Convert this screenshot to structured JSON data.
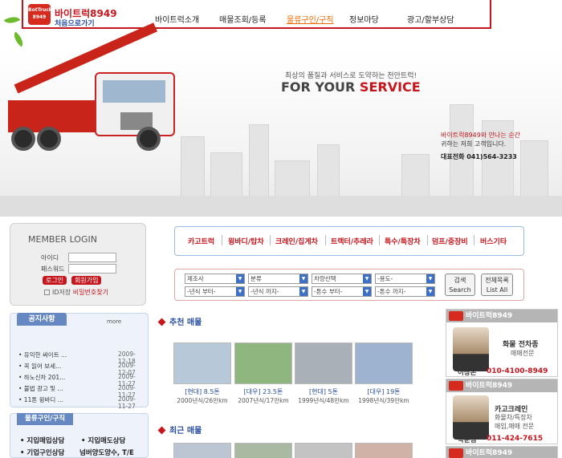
{
  "header": {
    "logo_text": "BotTruck 8949",
    "brand": "바이트럭8949",
    "brand_sub": "처음으로가기",
    "nav": [
      "바이트럭소개",
      "매물조회/등록",
      "물류구인/구직",
      "정보마당",
      "광고/할부상담"
    ]
  },
  "hero": {
    "slogan": "최상의 품질과 서비스로 도약하는 천안트럭!",
    "service_main": "FOR YOUR ",
    "service_accent": "SERVICE",
    "phone_line1": "바이트럭8949와 만나는 순간",
    "phone_line2": "귀하는 저희 고객입니다.",
    "phone_label": "대표전화 041)564-3233"
  },
  "login": {
    "title": "MEMBER LOGIN",
    "id_label": "아이디",
    "pw_label": "패스워드",
    "login_btn": "로그인",
    "join_btn": "회원가입",
    "id_save": "ID저장",
    "find_pw": "비밀번호찾기"
  },
  "categories": [
    "카고트럭",
    "윙바디/탑차",
    "크레인/집게차",
    "트랙터/추레라",
    "특수/특장차",
    "덤프/중장비",
    "버스기타"
  ],
  "search": {
    "row1": [
      "제조사",
      "분류",
      "차량선택",
      "-용도-"
    ],
    "row2": [
      "-년식 부터-",
      "-년식 까지-",
      "-톤수 부터-",
      "-톤수 까지-"
    ],
    "search_btn": "검색",
    "search_btn_en": "Search",
    "list_btn": "전체목록",
    "list_btn_en": "List All"
  },
  "notice": {
    "title": "공지사항",
    "more": "more",
    "items": [
      {
        "title": "• 유익한 싸이트 ...",
        "date": "2009-12-18"
      },
      {
        "title": "• 꼭 읽어 보세...",
        "date": "2009-12-07"
      },
      {
        "title": "• 하노신차 201...",
        "date": "2009-11-27"
      },
      {
        "title": "• 불법 광고 및 ...",
        "date": "2009-11-27"
      },
      {
        "title": "• 11톤 윙바디 ...",
        "date": "2009-11-27"
      }
    ]
  },
  "job": {
    "title": "물류구인/구직",
    "items": [
      "• 지입매입상담",
      "• 지입매도상담",
      "• 기업구인상담",
      "넘버양도양수, T/E"
    ]
  },
  "recommended": {
    "title": "추천 매물",
    "cards": [
      {
        "line1": "[현대] 8.5톤",
        "line2": "2000년식/26만km",
        "color": "#b7c9d8"
      },
      {
        "line1": "[대우] 23.5톤",
        "line2": "2007년식/17만km",
        "color": "#8fb67f"
      },
      {
        "line1": "[현대] 5톤",
        "line2": "1999년식/48만km",
        "color": "#a9b0b8"
      },
      {
        "line1": "[대우] 19톤",
        "line2": "1998년식/39만km",
        "color": "#9eb3cf"
      }
    ]
  },
  "recent": {
    "title": "최근 매물"
  },
  "dealers": [
    {
      "head": "바이트럭8949",
      "t1": "화물 전차종",
      "t2": "매매전문",
      "name": "이상돈",
      "phone": "010-4100-8949"
    },
    {
      "head": "바이트럭8949",
      "t1": "카고크레인",
      "t2": "화물차/특장차",
      "t3": "매입,매매 전문",
      "name": "박순범",
      "phone": "011-424-7615"
    },
    {
      "head": "바이트럭8949"
    }
  ]
}
